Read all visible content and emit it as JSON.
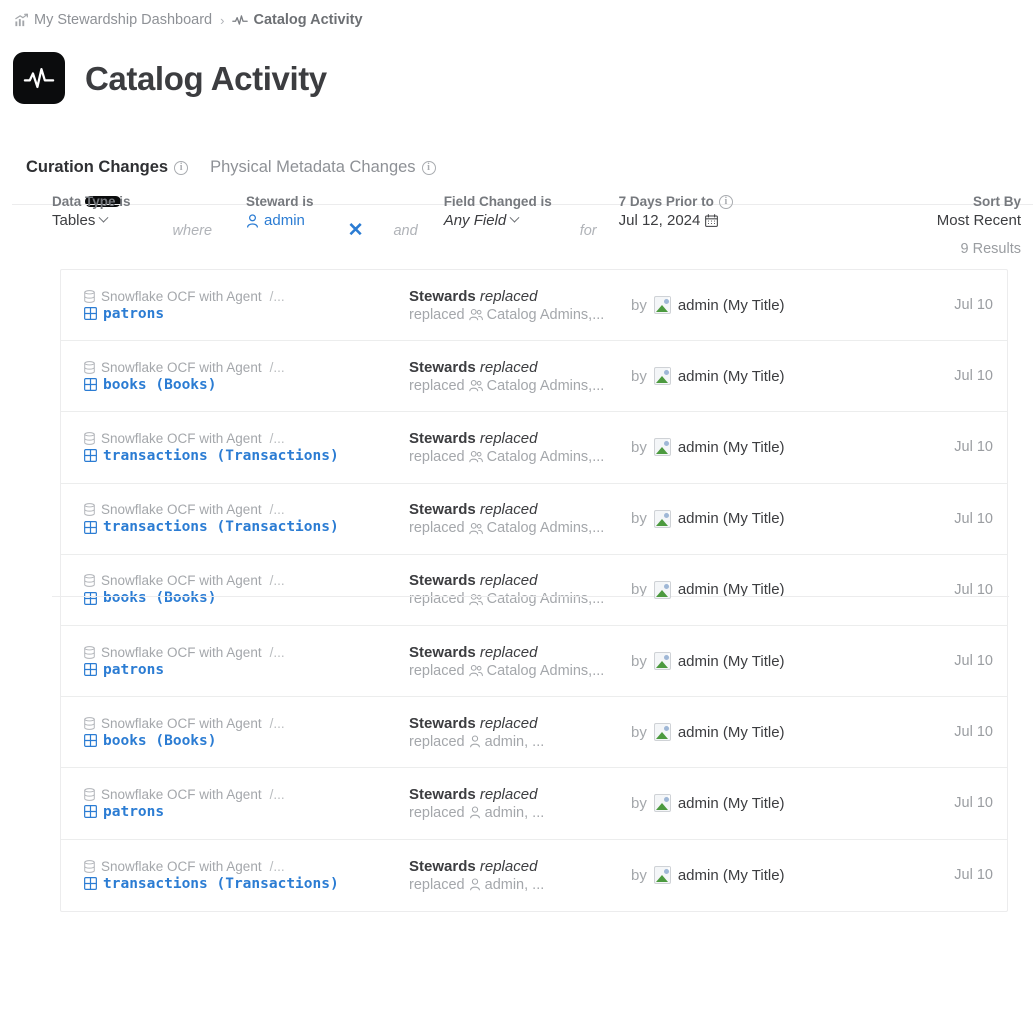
{
  "breadcrumb": {
    "items": [
      {
        "label": "My Stewardship Dashboard",
        "icon": "bar-chart-trend-icon",
        "current": false
      },
      {
        "label": "Catalog Activity",
        "icon": "activity-pulse-icon",
        "current": true
      }
    ],
    "separator": "›"
  },
  "header": {
    "title": "Catalog Activity",
    "app_icon": "activity-pulse-icon",
    "app_icon_bg": "#0b0c0d"
  },
  "tabs": [
    {
      "label": "Curation Changes",
      "active": true,
      "info": true
    },
    {
      "label": "Physical Metadata Changes",
      "active": false,
      "info": true
    }
  ],
  "filters": {
    "data_type": {
      "label": "Data Type is",
      "value": "Tables",
      "has_caret": true
    },
    "conj_where": "where",
    "steward": {
      "label": "Steward is",
      "value": "admin",
      "icon": "person-icon",
      "clear": "✕"
    },
    "conj_and": "and",
    "field_changed": {
      "label": "Field Changed is",
      "value": "Any Field",
      "has_caret": true
    },
    "conj_for": "for",
    "date": {
      "label": "7 Days Prior to",
      "value": "Jul 12, 2024",
      "icon": "calendar-icon",
      "info": true
    }
  },
  "sort": {
    "label": "Sort By",
    "value": "Most Recent"
  },
  "results_count": "9 Results",
  "colors": {
    "link": "#2b7cd3",
    "muted": "#a4a7ab",
    "text": "#3c3d40",
    "border": "#ececed"
  },
  "rows": [
    {
      "source": "Snowflake OCF with Agent",
      "path_more": "/...",
      "asset": "patrons",
      "asset_icon": "table-grid-icon",
      "source_icon": "database-icon",
      "change_field": "Stewards",
      "change_action": "replaced",
      "change_detail_verb": "replaced",
      "change_detail_value": "Catalog Admins,...",
      "change_detail_icon": "group-icon",
      "by_word": "by",
      "by_name": "admin (My Title)",
      "avatar": "broken-image-icon",
      "date": "Jul 10"
    },
    {
      "source": "Snowflake OCF with Agent",
      "path_more": "/...",
      "asset": "books (Books)",
      "asset_icon": "table-grid-icon",
      "source_icon": "database-icon",
      "change_field": "Stewards",
      "change_action": "replaced",
      "change_detail_verb": "replaced",
      "change_detail_value": "Catalog Admins,...",
      "change_detail_icon": "group-icon",
      "by_word": "by",
      "by_name": "admin (My Title)",
      "avatar": "broken-image-icon",
      "date": "Jul 10"
    },
    {
      "source": "Snowflake OCF with Agent",
      "path_more": "/...",
      "asset": "transactions (Transactions)",
      "asset_icon": "table-grid-icon",
      "source_icon": "database-icon",
      "change_field": "Stewards",
      "change_action": "replaced",
      "change_detail_verb": "replaced",
      "change_detail_value": "Catalog Admins,...",
      "change_detail_icon": "group-icon",
      "by_word": "by",
      "by_name": "admin (My Title)",
      "avatar": "broken-image-icon",
      "date": "Jul 10"
    },
    {
      "source": "Snowflake OCF with Agent",
      "path_more": "/...",
      "asset": "transactions (Transactions)",
      "asset_icon": "table-grid-icon",
      "source_icon": "database-icon",
      "change_field": "Stewards",
      "change_action": "replaced",
      "change_detail_verb": "replaced",
      "change_detail_value": "Catalog Admins,...",
      "change_detail_icon": "group-icon",
      "by_word": "by",
      "by_name": "admin (My Title)",
      "avatar": "broken-image-icon",
      "date": "Jul 10"
    },
    {
      "source": "Snowflake OCF with Agent",
      "path_more": "/...",
      "asset": "books (Books)",
      "asset_icon": "table-grid-icon",
      "source_icon": "database-icon",
      "change_field": "Stewards",
      "change_action": "replaced",
      "change_detail_verb": "replaced",
      "change_detail_value": "Catalog Admins,...",
      "change_detail_icon": "group-icon",
      "by_word": "by",
      "by_name": "admin (My Title)",
      "avatar": "broken-image-icon",
      "date": "Jul 10"
    },
    {
      "source": "Snowflake OCF with Agent",
      "path_more": "/...",
      "asset": "patrons",
      "asset_icon": "table-grid-icon",
      "source_icon": "database-icon",
      "change_field": "Stewards",
      "change_action": "replaced",
      "change_detail_verb": "replaced",
      "change_detail_value": "Catalog Admins,...",
      "change_detail_icon": "group-icon",
      "by_word": "by",
      "by_name": "admin (My Title)",
      "avatar": "broken-image-icon",
      "date": "Jul 10"
    },
    {
      "source": "Snowflake OCF with Agent",
      "path_more": "/...",
      "asset": "books (Books)",
      "asset_icon": "table-grid-icon",
      "source_icon": "database-icon",
      "change_field": "Stewards",
      "change_action": "replaced",
      "change_detail_verb": "replaced",
      "change_detail_value": "admin, ...",
      "change_detail_icon": "person-icon",
      "by_word": "by",
      "by_name": "admin (My Title)",
      "avatar": "broken-image-icon",
      "date": "Jul 10"
    },
    {
      "source": "Snowflake OCF with Agent",
      "path_more": "/...",
      "asset": "patrons",
      "asset_icon": "table-grid-icon",
      "source_icon": "database-icon",
      "change_field": "Stewards",
      "change_action": "replaced",
      "change_detail_verb": "replaced",
      "change_detail_value": "admin, ...",
      "change_detail_icon": "person-icon",
      "by_word": "by",
      "by_name": "admin (My Title)",
      "avatar": "broken-image-icon",
      "date": "Jul 10"
    },
    {
      "source": "Snowflake OCF with Agent",
      "path_more": "/...",
      "asset": "transactions (Transactions)",
      "asset_icon": "table-grid-icon",
      "source_icon": "database-icon",
      "change_field": "Stewards",
      "change_action": "replaced",
      "change_detail_verb": "replaced",
      "change_detail_value": "admin, ...",
      "change_detail_icon": "person-icon",
      "by_word": "by",
      "by_name": "admin (My Title)",
      "avatar": "broken-image-icon",
      "date": "Jul 10"
    }
  ]
}
